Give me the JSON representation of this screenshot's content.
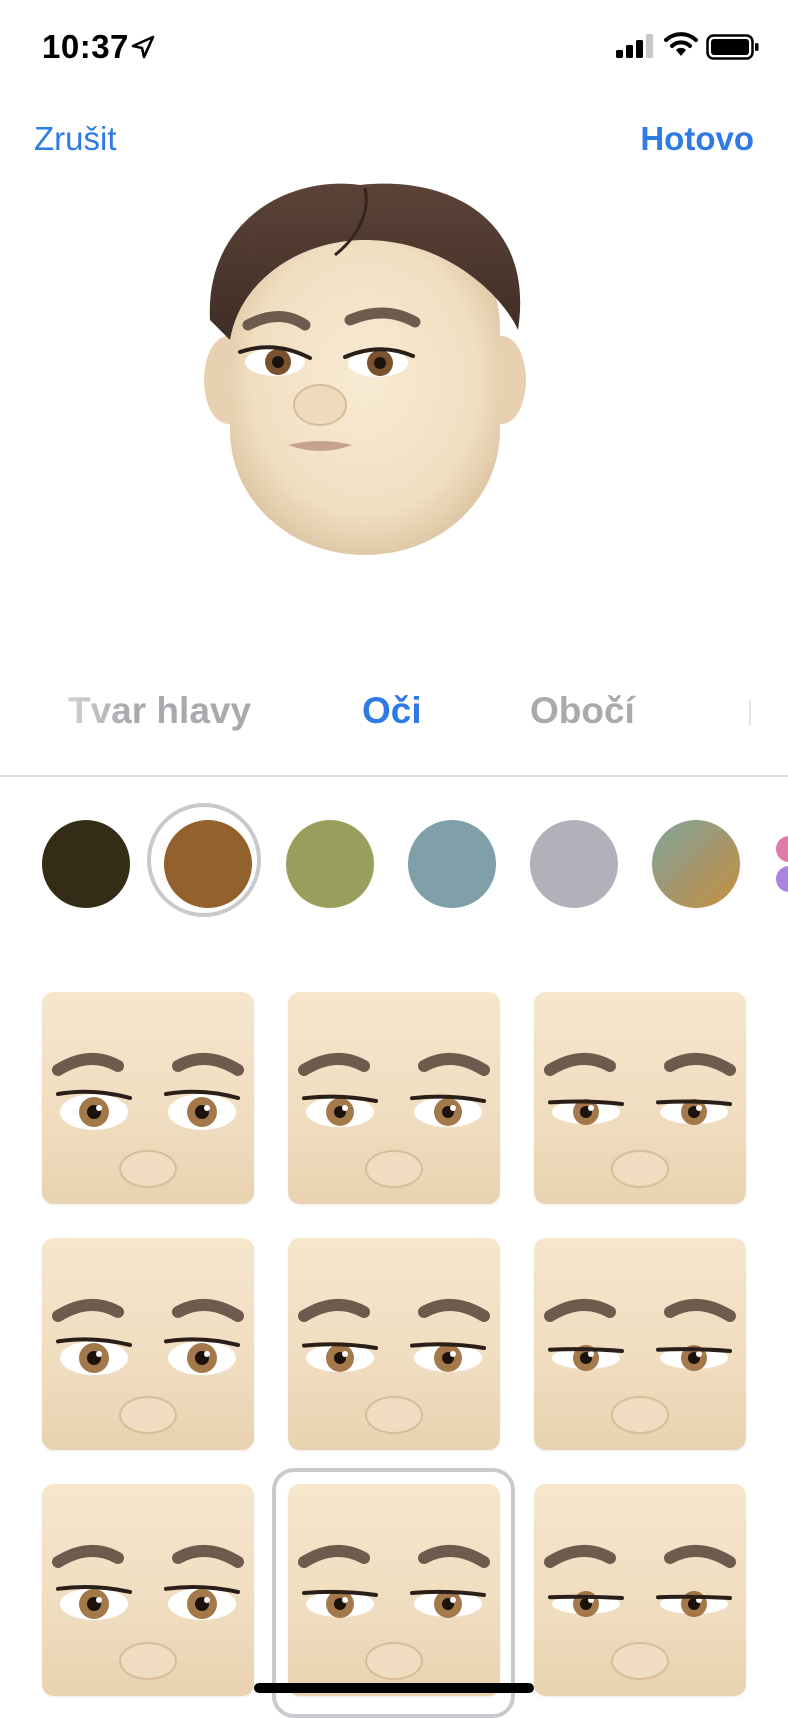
{
  "status_bar": {
    "time": "10:37"
  },
  "nav": {
    "cancel_label": "Zrušit",
    "done_label": "Hotovo"
  },
  "tabs": [
    {
      "label": "Tvar hlavy",
      "selected": false
    },
    {
      "label": "Oči",
      "selected": true
    },
    {
      "label": "Obočí",
      "selected": false
    }
  ],
  "eye_colors": [
    {
      "name": "dark-brown",
      "color": "#352c17",
      "selected": false
    },
    {
      "name": "brown",
      "color": "#93612c",
      "selected": true
    },
    {
      "name": "olive",
      "color": "#999e5c",
      "selected": false
    },
    {
      "name": "blue-grey",
      "color": "#7fa0a8",
      "selected": false
    },
    {
      "name": "grey",
      "color": "#b1b2b9",
      "selected": false
    },
    {
      "name": "multicolor",
      "color": "gradient",
      "selected": false
    }
  ],
  "eye_styles": [
    {
      "name": "eyes-style-1",
      "selected": false
    },
    {
      "name": "eyes-style-2",
      "selected": false
    },
    {
      "name": "eyes-style-3",
      "selected": false
    },
    {
      "name": "eyes-style-4",
      "selected": false
    },
    {
      "name": "eyes-style-5",
      "selected": false
    },
    {
      "name": "eyes-style-6",
      "selected": false
    },
    {
      "name": "eyes-style-7",
      "selected": false
    },
    {
      "name": "eyes-style-8",
      "selected": true
    },
    {
      "name": "eyes-style-9",
      "selected": false
    }
  ],
  "colors": {
    "accent": "#2f7ae5",
    "inactive_tab": "#a9a9ae"
  }
}
